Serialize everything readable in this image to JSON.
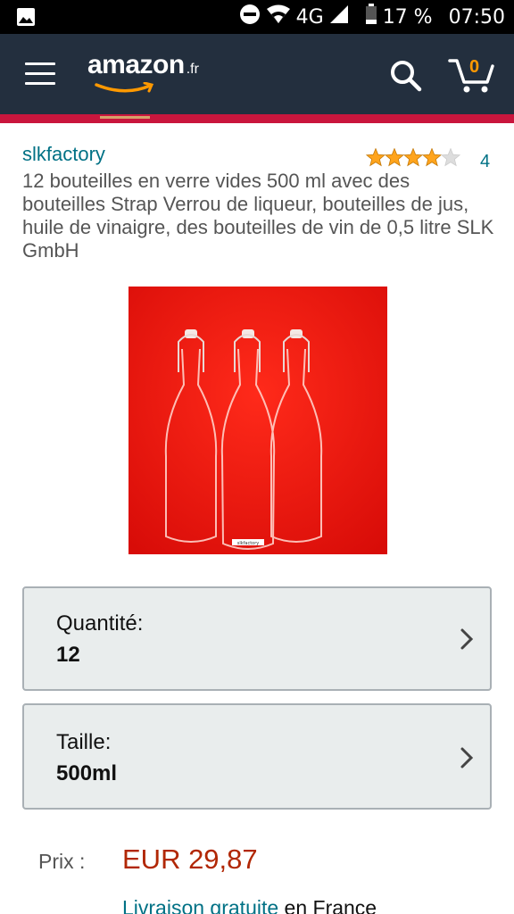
{
  "status_bar": {
    "network": "4G",
    "battery": "17 %",
    "time": "07:50",
    "icons": [
      "image-icon",
      "do-not-disturb-icon",
      "wifi-icon",
      "signal-icon",
      "battery-icon"
    ]
  },
  "header": {
    "logo_word": "amazon",
    "logo_tld": ".fr",
    "cart_count": "0",
    "icons": [
      "menu-icon",
      "search-icon",
      "cart-icon"
    ],
    "colors": {
      "bar": "#232f3e",
      "accent": "#ff9900",
      "strip": "#c9163d"
    }
  },
  "product": {
    "brand": "slkfactory",
    "rating_stars": 4,
    "rating_count": "4",
    "title": "12 bouteilles en verre vides 500 ml avec des bouteilles Strap Verrou de liqueur, bouteilles de jus, huile de vinaigre, des bouteilles de vin de 0,5 litre SLK GmbH",
    "image_label": "slkfactory"
  },
  "variations": [
    {
      "label": "Quantité:",
      "value": "12"
    },
    {
      "label": "Taille:",
      "value": "500ml"
    }
  ],
  "price": {
    "label": "Prix :",
    "value": "EUR 29,87"
  },
  "delivery": {
    "link_text": "Livraison gratuite",
    "rest": " en France"
  }
}
